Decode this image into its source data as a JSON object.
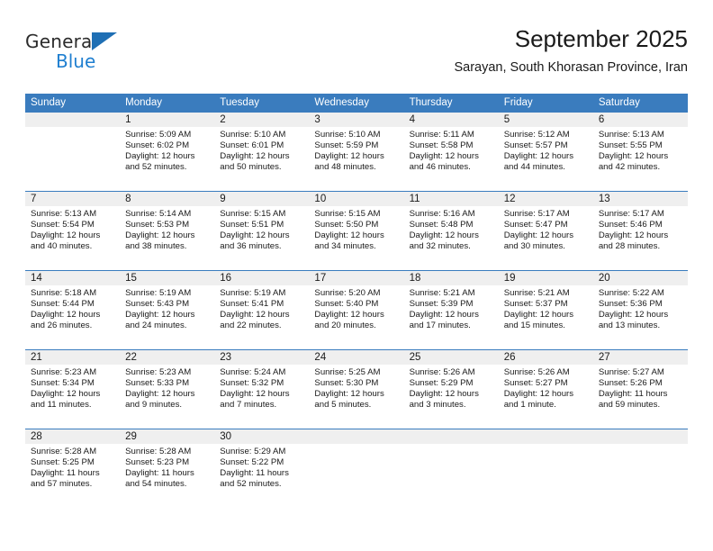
{
  "brand": {
    "name_top": "General",
    "name_bottom": "Blue",
    "accent_color": "#1f7fd0",
    "header_color": "#3a7cbe"
  },
  "header": {
    "title": "September 2025",
    "subtitle": "Sarayan, South Khorasan Province, Iran"
  },
  "weekdays": [
    "Sunday",
    "Monday",
    "Tuesday",
    "Wednesday",
    "Thursday",
    "Friday",
    "Saturday"
  ],
  "weeks": [
    [
      {
        "day": "",
        "sunrise": "",
        "sunset": "",
        "daylight1": "",
        "daylight2": ""
      },
      {
        "day": "1",
        "sunrise": "Sunrise: 5:09 AM",
        "sunset": "Sunset: 6:02 PM",
        "daylight1": "Daylight: 12 hours",
        "daylight2": "and 52 minutes."
      },
      {
        "day": "2",
        "sunrise": "Sunrise: 5:10 AM",
        "sunset": "Sunset: 6:01 PM",
        "daylight1": "Daylight: 12 hours",
        "daylight2": "and 50 minutes."
      },
      {
        "day": "3",
        "sunrise": "Sunrise: 5:10 AM",
        "sunset": "Sunset: 5:59 PM",
        "daylight1": "Daylight: 12 hours",
        "daylight2": "and 48 minutes."
      },
      {
        "day": "4",
        "sunrise": "Sunrise: 5:11 AM",
        "sunset": "Sunset: 5:58 PM",
        "daylight1": "Daylight: 12 hours",
        "daylight2": "and 46 minutes."
      },
      {
        "day": "5",
        "sunrise": "Sunrise: 5:12 AM",
        "sunset": "Sunset: 5:57 PM",
        "daylight1": "Daylight: 12 hours",
        "daylight2": "and 44 minutes."
      },
      {
        "day": "6",
        "sunrise": "Sunrise: 5:13 AM",
        "sunset": "Sunset: 5:55 PM",
        "daylight1": "Daylight: 12 hours",
        "daylight2": "and 42 minutes."
      }
    ],
    [
      {
        "day": "7",
        "sunrise": "Sunrise: 5:13 AM",
        "sunset": "Sunset: 5:54 PM",
        "daylight1": "Daylight: 12 hours",
        "daylight2": "and 40 minutes."
      },
      {
        "day": "8",
        "sunrise": "Sunrise: 5:14 AM",
        "sunset": "Sunset: 5:53 PM",
        "daylight1": "Daylight: 12 hours",
        "daylight2": "and 38 minutes."
      },
      {
        "day": "9",
        "sunrise": "Sunrise: 5:15 AM",
        "sunset": "Sunset: 5:51 PM",
        "daylight1": "Daylight: 12 hours",
        "daylight2": "and 36 minutes."
      },
      {
        "day": "10",
        "sunrise": "Sunrise: 5:15 AM",
        "sunset": "Sunset: 5:50 PM",
        "daylight1": "Daylight: 12 hours",
        "daylight2": "and 34 minutes."
      },
      {
        "day": "11",
        "sunrise": "Sunrise: 5:16 AM",
        "sunset": "Sunset: 5:48 PM",
        "daylight1": "Daylight: 12 hours",
        "daylight2": "and 32 minutes."
      },
      {
        "day": "12",
        "sunrise": "Sunrise: 5:17 AM",
        "sunset": "Sunset: 5:47 PM",
        "daylight1": "Daylight: 12 hours",
        "daylight2": "and 30 minutes."
      },
      {
        "day": "13",
        "sunrise": "Sunrise: 5:17 AM",
        "sunset": "Sunset: 5:46 PM",
        "daylight1": "Daylight: 12 hours",
        "daylight2": "and 28 minutes."
      }
    ],
    [
      {
        "day": "14",
        "sunrise": "Sunrise: 5:18 AM",
        "sunset": "Sunset: 5:44 PM",
        "daylight1": "Daylight: 12 hours",
        "daylight2": "and 26 minutes."
      },
      {
        "day": "15",
        "sunrise": "Sunrise: 5:19 AM",
        "sunset": "Sunset: 5:43 PM",
        "daylight1": "Daylight: 12 hours",
        "daylight2": "and 24 minutes."
      },
      {
        "day": "16",
        "sunrise": "Sunrise: 5:19 AM",
        "sunset": "Sunset: 5:41 PM",
        "daylight1": "Daylight: 12 hours",
        "daylight2": "and 22 minutes."
      },
      {
        "day": "17",
        "sunrise": "Sunrise: 5:20 AM",
        "sunset": "Sunset: 5:40 PM",
        "daylight1": "Daylight: 12 hours",
        "daylight2": "and 20 minutes."
      },
      {
        "day": "18",
        "sunrise": "Sunrise: 5:21 AM",
        "sunset": "Sunset: 5:39 PM",
        "daylight1": "Daylight: 12 hours",
        "daylight2": "and 17 minutes."
      },
      {
        "day": "19",
        "sunrise": "Sunrise: 5:21 AM",
        "sunset": "Sunset: 5:37 PM",
        "daylight1": "Daylight: 12 hours",
        "daylight2": "and 15 minutes."
      },
      {
        "day": "20",
        "sunrise": "Sunrise: 5:22 AM",
        "sunset": "Sunset: 5:36 PM",
        "daylight1": "Daylight: 12 hours",
        "daylight2": "and 13 minutes."
      }
    ],
    [
      {
        "day": "21",
        "sunrise": "Sunrise: 5:23 AM",
        "sunset": "Sunset: 5:34 PM",
        "daylight1": "Daylight: 12 hours",
        "daylight2": "and 11 minutes."
      },
      {
        "day": "22",
        "sunrise": "Sunrise: 5:23 AM",
        "sunset": "Sunset: 5:33 PM",
        "daylight1": "Daylight: 12 hours",
        "daylight2": "and 9 minutes."
      },
      {
        "day": "23",
        "sunrise": "Sunrise: 5:24 AM",
        "sunset": "Sunset: 5:32 PM",
        "daylight1": "Daylight: 12 hours",
        "daylight2": "and 7 minutes."
      },
      {
        "day": "24",
        "sunrise": "Sunrise: 5:25 AM",
        "sunset": "Sunset: 5:30 PM",
        "daylight1": "Daylight: 12 hours",
        "daylight2": "and 5 minutes."
      },
      {
        "day": "25",
        "sunrise": "Sunrise: 5:26 AM",
        "sunset": "Sunset: 5:29 PM",
        "daylight1": "Daylight: 12 hours",
        "daylight2": "and 3 minutes."
      },
      {
        "day": "26",
        "sunrise": "Sunrise: 5:26 AM",
        "sunset": "Sunset: 5:27 PM",
        "daylight1": "Daylight: 12 hours",
        "daylight2": "and 1 minute."
      },
      {
        "day": "27",
        "sunrise": "Sunrise: 5:27 AM",
        "sunset": "Sunset: 5:26 PM",
        "daylight1": "Daylight: 11 hours",
        "daylight2": "and 59 minutes."
      }
    ],
    [
      {
        "day": "28",
        "sunrise": "Sunrise: 5:28 AM",
        "sunset": "Sunset: 5:25 PM",
        "daylight1": "Daylight: 11 hours",
        "daylight2": "and 57 minutes."
      },
      {
        "day": "29",
        "sunrise": "Sunrise: 5:28 AM",
        "sunset": "Sunset: 5:23 PM",
        "daylight1": "Daylight: 11 hours",
        "daylight2": "and 54 minutes."
      },
      {
        "day": "30",
        "sunrise": "Sunrise: 5:29 AM",
        "sunset": "Sunset: 5:22 PM",
        "daylight1": "Daylight: 11 hours",
        "daylight2": "and 52 minutes."
      },
      {
        "day": "",
        "sunrise": "",
        "sunset": "",
        "daylight1": "",
        "daylight2": ""
      },
      {
        "day": "",
        "sunrise": "",
        "sunset": "",
        "daylight1": "",
        "daylight2": ""
      },
      {
        "day": "",
        "sunrise": "",
        "sunset": "",
        "daylight1": "",
        "daylight2": ""
      },
      {
        "day": "",
        "sunrise": "",
        "sunset": "",
        "daylight1": "",
        "daylight2": ""
      }
    ]
  ]
}
